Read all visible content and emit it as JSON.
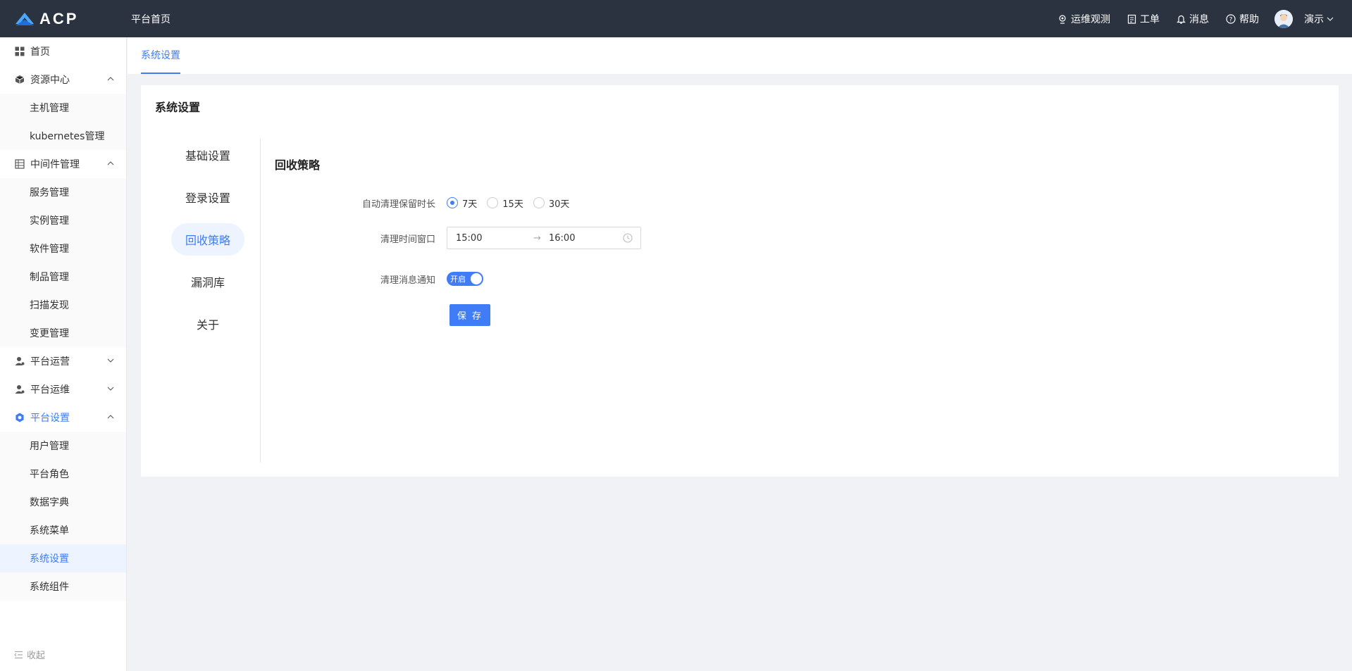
{
  "header": {
    "logo_text": "ACP",
    "home_link": "平台首页",
    "items": [
      {
        "label": "运维观测",
        "icon": "eye-icon"
      },
      {
        "label": "工单",
        "icon": "clipboard-icon"
      },
      {
        "label": "消息",
        "icon": "bell-icon"
      },
      {
        "label": "帮助",
        "icon": "help-icon"
      }
    ],
    "user_name": "演示"
  },
  "sidebar": {
    "home": "首页",
    "resource_center": "资源中心",
    "resource_children": [
      "主机管理",
      "kubernetes管理"
    ],
    "middleware": "中间件管理",
    "middleware_children": [
      "服务管理",
      "实例管理",
      "软件管理",
      "制品管理",
      "扫描发现",
      "变更管理"
    ],
    "platform_ops": "平台运营",
    "platform_maint": "平台运维",
    "platform_settings": "平台设置",
    "settings_children": [
      "用户管理",
      "平台角色",
      "数据字典",
      "系统菜单",
      "系统设置",
      "系统组件"
    ],
    "collapse": "收起"
  },
  "tabs": {
    "active": "系统设置"
  },
  "card": {
    "title": "系统设置",
    "nav": [
      "基础设置",
      "登录设置",
      "回收策略",
      "漏洞库",
      "关于"
    ],
    "panel_title": "回收策略",
    "retention_label": "自动清理保留时长",
    "retention_options": [
      "7天",
      "15天",
      "30天"
    ],
    "retention_selected": "7天",
    "window_label": "清理时间窗口",
    "window_start": "15:00",
    "window_sep": "→",
    "window_end": "16:00",
    "notify_label": "清理消息通知",
    "notify_switch_text": "开启",
    "save_label": "保 存"
  },
  "colors": {
    "accent": "#3f7cf6",
    "header_bg": "#2b3240"
  }
}
